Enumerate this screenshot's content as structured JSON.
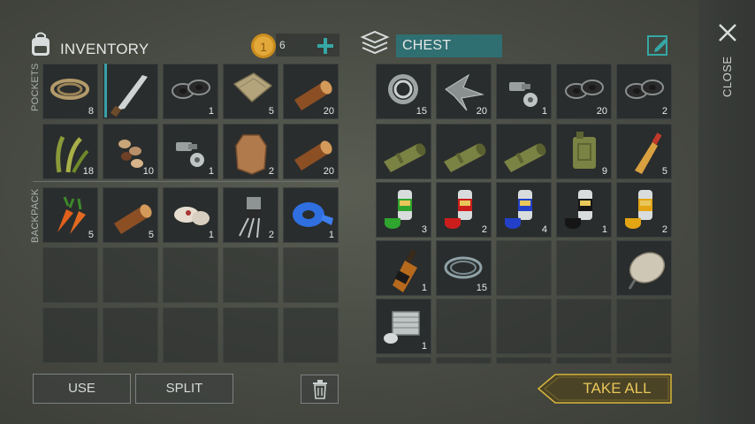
{
  "inventory": {
    "title": "INVENTORY",
    "coins": "6",
    "pockets_label": "POCKETS",
    "backpack_label": "BACKPACK",
    "pockets": [
      {
        "icon": "rope-icon",
        "count": "8"
      },
      {
        "icon": "machete-icon",
        "count": ""
      },
      {
        "icon": "washers-icon",
        "count": "1"
      },
      {
        "icon": "cloth-icon",
        "count": "5"
      },
      {
        "icon": "log-icon",
        "count": "20"
      },
      {
        "icon": "plant-fiber-icon",
        "count": "18"
      },
      {
        "icon": "seeds-icon",
        "count": "10"
      },
      {
        "icon": "bolt-nut-icon",
        "count": "1"
      },
      {
        "icon": "hide-icon",
        "count": "2"
      },
      {
        "icon": "log-icon",
        "count": "20"
      }
    ],
    "backpack": [
      {
        "icon": "carrots-icon",
        "count": "5"
      },
      {
        "icon": "log-icon",
        "count": "5"
      },
      {
        "icon": "meat-bone-icon",
        "count": "1"
      },
      {
        "icon": "transistor-icon",
        "count": "2"
      },
      {
        "icon": "blue-tape-icon",
        "count": "1"
      }
    ]
  },
  "chest": {
    "title": "CHEST",
    "items": [
      {
        "icon": "bearing-icon",
        "count": "15"
      },
      {
        "icon": "scrap-metal-icon",
        "count": "20"
      },
      {
        "icon": "bolt-nut-icon",
        "count": "1"
      },
      {
        "icon": "washers-icon",
        "count": "20"
      },
      {
        "icon": "washers-icon",
        "count": "2"
      },
      {
        "icon": "pipe-icon",
        "count": ""
      },
      {
        "icon": "pipe-icon",
        "count": ""
      },
      {
        "icon": "pipe-icon",
        "count": ""
      },
      {
        "icon": "jerrycan-icon",
        "count": "9"
      },
      {
        "icon": "bottle-icon",
        "count": "5"
      },
      {
        "icon": "green-paint-icon",
        "count": "3"
      },
      {
        "icon": "red-paint-icon",
        "count": "2"
      },
      {
        "icon": "blue-paint-icon",
        "count": "4"
      },
      {
        "icon": "black-paint-icon",
        "count": "1"
      },
      {
        "icon": "yellow-paint-icon",
        "count": "2"
      },
      {
        "icon": "whiskey-icon",
        "count": "1"
      },
      {
        "icon": "wire-icon",
        "count": "15"
      },
      {
        "icon": "",
        "count": ""
      },
      {
        "icon": "",
        "count": ""
      },
      {
        "icon": "satellite-dish-icon",
        "count": ""
      },
      {
        "icon": "engine-part-icon",
        "count": "1"
      }
    ]
  },
  "buttons": {
    "use": "USE",
    "split": "SPLIT",
    "take_all": "TAKE ALL",
    "close": "CLOSE"
  },
  "colors": {
    "accent": "#3aa0a8",
    "take_all": "#e8c65a",
    "paint": [
      "#2fa52f",
      "#cc1d1d",
      "#2340c8",
      "#151515",
      "#e3a514"
    ]
  }
}
